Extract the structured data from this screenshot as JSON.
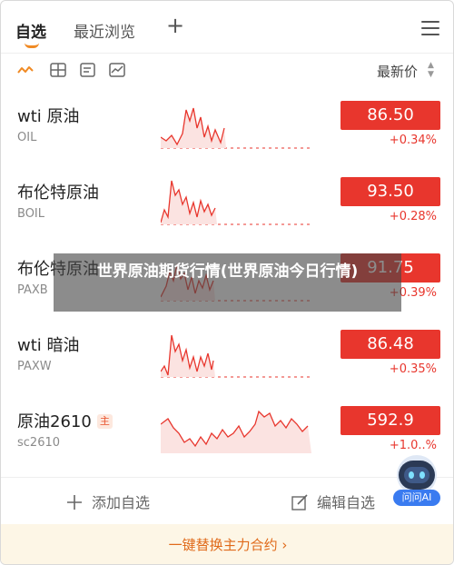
{
  "tabs": [
    {
      "label": "自选",
      "active": true
    },
    {
      "label": "最近浏览",
      "active": false
    }
  ],
  "tab_add": "+",
  "toolbar": {
    "icons": [
      "line-chart-icon",
      "grid-icon",
      "list-icon",
      "kline-icon"
    ],
    "sort_label": "最新价"
  },
  "rows": [
    {
      "name": "wti 原油",
      "code": "OIL",
      "badge": "",
      "price": "86.50",
      "change": "+0.34%"
    },
    {
      "name": "布伦特原油",
      "code": "BOIL",
      "badge": "",
      "price": "93.50",
      "change": "+0.28%"
    },
    {
      "name": "布伦特原油",
      "code": "PAXB",
      "badge": "",
      "price": "91.75",
      "change": "+0.39%"
    },
    {
      "name": "wti 暗油",
      "code": "PAXW",
      "badge": "",
      "price": "86.48",
      "change": "+0.35%"
    },
    {
      "name": "原油2610",
      "code": "sc2610",
      "badge": "主",
      "price": "592.9",
      "change": "+1.0..%"
    }
  ],
  "actions": {
    "add": "添加自选",
    "edit": "编辑自选"
  },
  "promo": "一键替换主力合约 ›",
  "ai_label": "问问AI",
  "overlay": "世界原油期货行情(世界原油今日行情)",
  "colors": {
    "up_red": "#e8362d",
    "accent_orange": "#f08a24",
    "promo_bg": "#fdf6e6",
    "ai_blue": "#3a7bf0"
  }
}
